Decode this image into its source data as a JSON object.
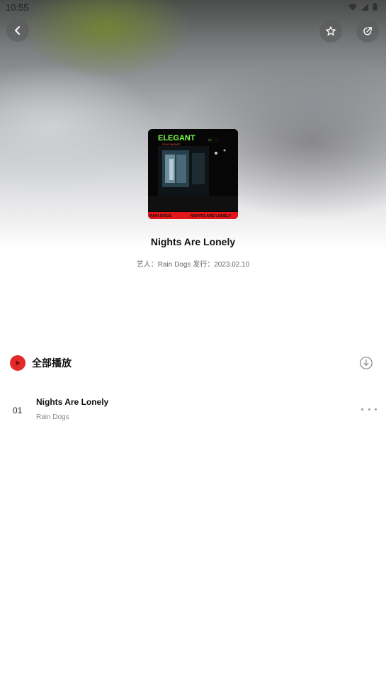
{
  "status_bar": {
    "time": "10:55"
  },
  "header": {
    "back_icon": "chevron-left-icon",
    "favorite_icon": "star-icon",
    "share_icon": "share-icon"
  },
  "album": {
    "title": "Nights Are Lonely",
    "meta": "艺人：Rain Dogs 发行：2023.02.10",
    "cover": {
      "sign_text": "ELEGANT",
      "sign_subtext": "FOOD MARKET",
      "band_left": "RAIN DOGS",
      "band_right": "NIGHTS ARE LONELY"
    }
  },
  "actions": {
    "play_all_label": "全部播放",
    "download_icon": "download-icon"
  },
  "tracks": [
    {
      "number": "01",
      "title": "Nights Are Lonely",
      "artist": "Rain Dogs"
    }
  ],
  "colors": {
    "accent": "#e42929"
  }
}
